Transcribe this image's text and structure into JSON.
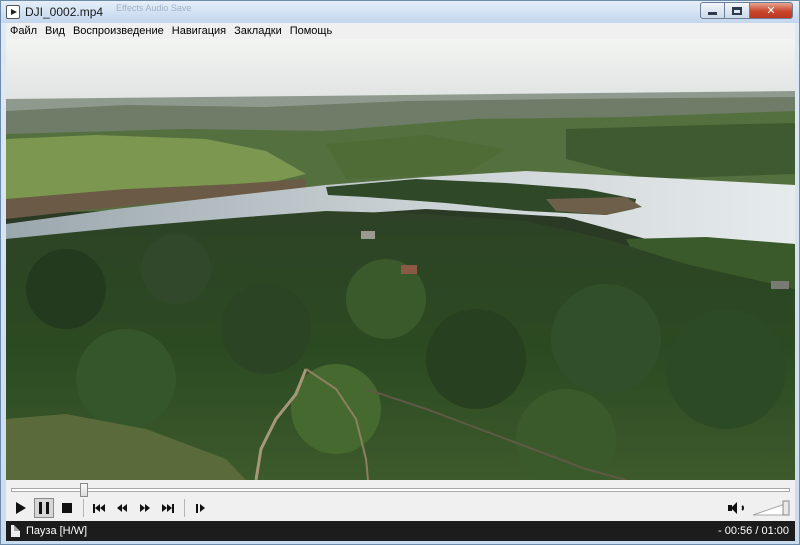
{
  "window": {
    "title": "DJI_0002.mp4",
    "ghost_text": "Effects Audio Save"
  },
  "menu": {
    "items": [
      "Файл",
      "Вид",
      "Воспроизведение",
      "Навигация",
      "Закладки",
      "Помощь"
    ]
  },
  "player": {
    "progress_fraction": 0.0933,
    "volume_fraction": 1.0,
    "state": "paused",
    "icons": [
      "play-icon",
      "pause-icon",
      "stop-icon",
      "previous-icon",
      "rewind-icon",
      "fast-forward-icon",
      "next-icon",
      "frame-step-icon",
      "speaker-icon"
    ]
  },
  "status": {
    "text": "Пауза [H/W]",
    "time": "- 00:56 / 01:00"
  },
  "colors": {
    "status_bg": "#1c1c1c",
    "controls_bg": "#f0f0f0",
    "close_button": "#c9452b"
  }
}
